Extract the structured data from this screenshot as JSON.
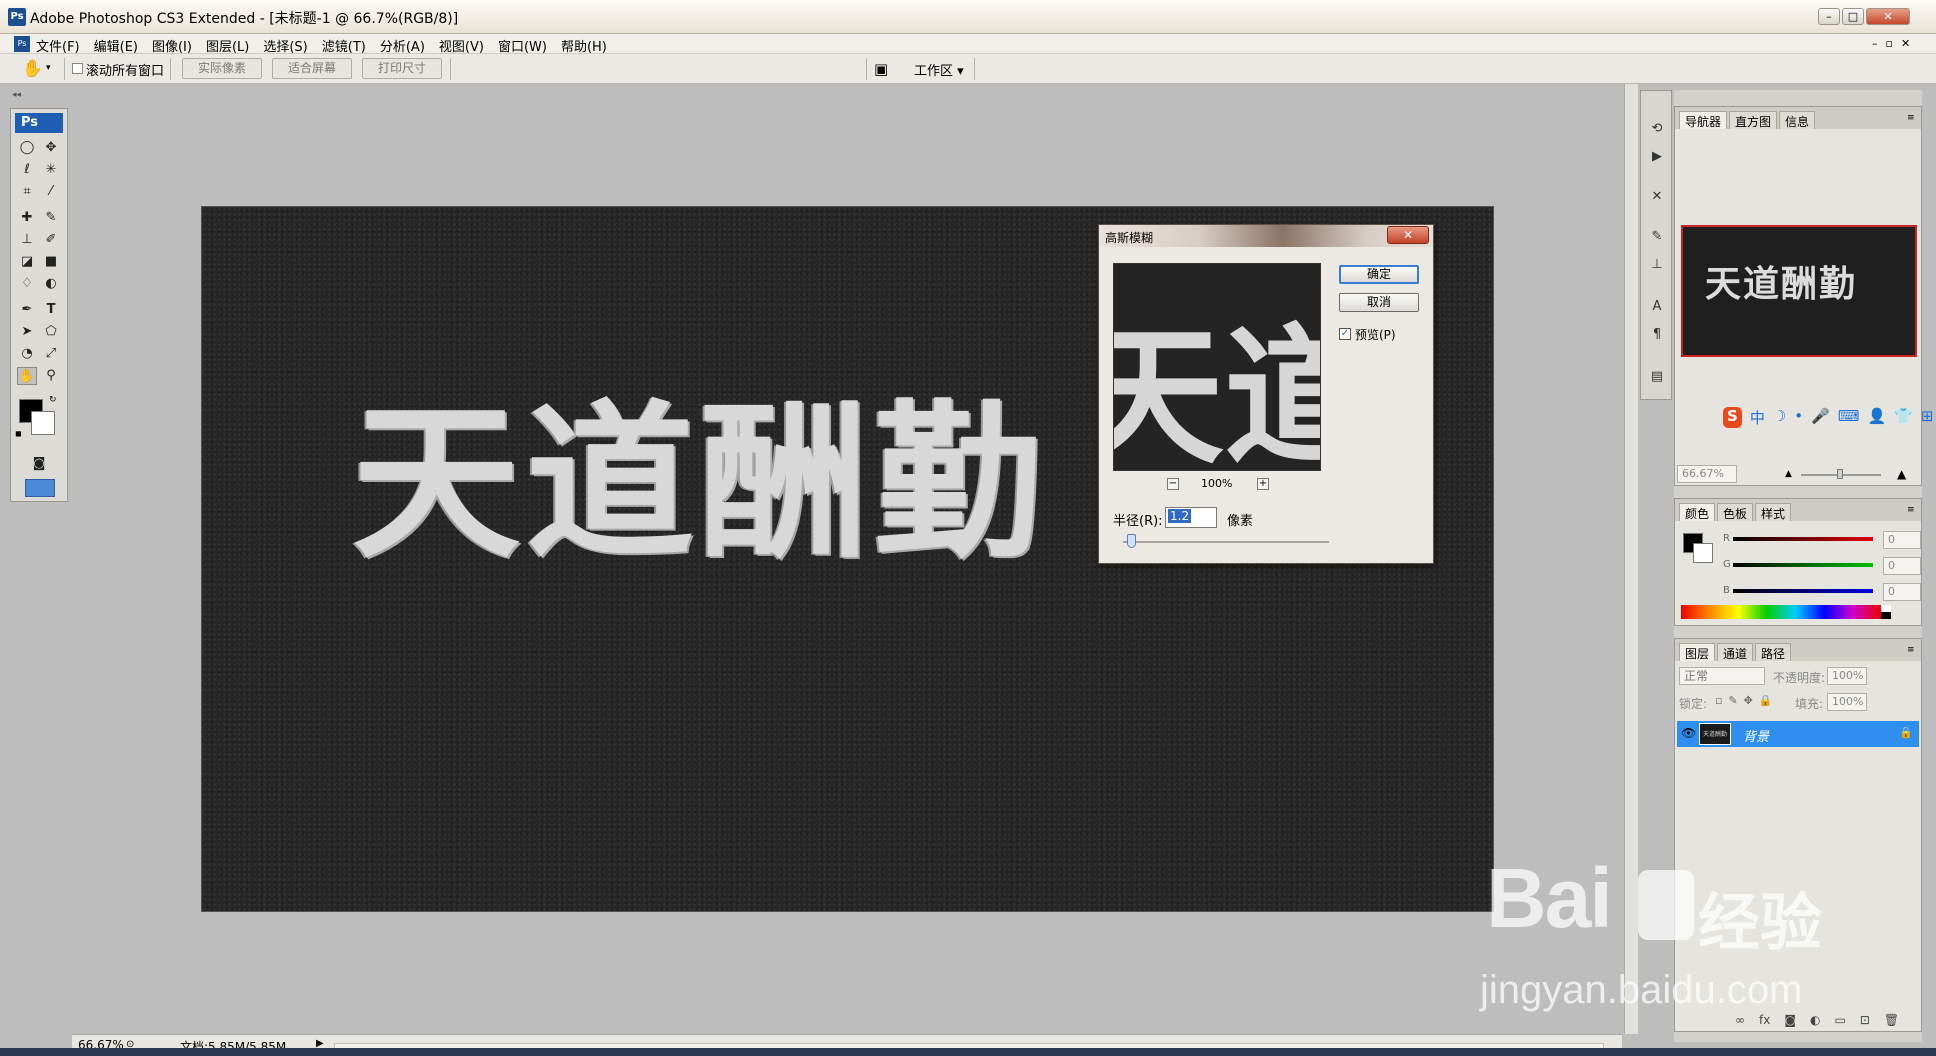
{
  "window": {
    "title": "Adobe Photoshop CS3 Extended - [未标题-1 @ 66.7%(RGB/8)]",
    "minimize": "–",
    "maximize": "□",
    "close": "✕"
  },
  "menu": {
    "items": [
      "文件(F)",
      "编辑(E)",
      "图像(I)",
      "图层(L)",
      "选择(S)",
      "滤镜(T)",
      "分析(A)",
      "视图(V)",
      "窗口(W)",
      "帮助(H)"
    ]
  },
  "options": {
    "scroll_all_label": "滚动所有窗口",
    "actual_pixels": "实际像素",
    "fit_screen": "适合屏幕",
    "print_size": "打印尺寸",
    "workspace": "工作区 ▾"
  },
  "toolbox": {
    "logo": "Ps"
  },
  "document": {
    "text": "天道酬勤"
  },
  "dialog": {
    "title": "高斯模糊",
    "ok": "确定",
    "cancel": "取消",
    "preview_label": "预览(P)",
    "zoom_value": "100%",
    "zoom_out": "−",
    "zoom_in": "+",
    "radius_label": "半径(R):",
    "radius_value": "1.2",
    "unit": "像素",
    "close": "✕"
  },
  "navigator": {
    "tabs": [
      "导航器",
      "直方图",
      "信息"
    ],
    "thumb_text": "天道酬勤",
    "zoom": "66.67%"
  },
  "color_panel": {
    "tabs": [
      "颜色",
      "色板",
      "样式"
    ],
    "channels": [
      {
        "label": "R",
        "value": "0",
        "color": "#cc0000"
      },
      {
        "label": "G",
        "value": "0",
        "color": "#00aa00"
      },
      {
        "label": "B",
        "value": "0",
        "color": "#0000cc"
      }
    ]
  },
  "layers_panel": {
    "tabs": [
      "图层",
      "通道",
      "路径"
    ],
    "blend_mode": "正常",
    "opacity_label": "不透明度:",
    "opacity_value": "100%",
    "lock_label": "锁定:",
    "fill_label": "填充:",
    "fill_value": "100%",
    "layer_name": "背景",
    "layer_thumb_text": "天道酬勤"
  },
  "ime_bar": {
    "items": [
      "S",
      "中",
      "☽",
      "•",
      "🎤",
      "⌨",
      "👤",
      "👕",
      "⊞"
    ]
  },
  "status": {
    "zoom": "66.67%",
    "doc": "文档:5.85M/5.85M"
  },
  "watermark": {
    "brand": "Bai",
    "brand2": "经验",
    "url": "jingyan.baidu.com"
  },
  "colors": {
    "accent": "#2f8ff0",
    "ps_blue": "#1e5fb5",
    "nav_border": "#cc2222"
  }
}
